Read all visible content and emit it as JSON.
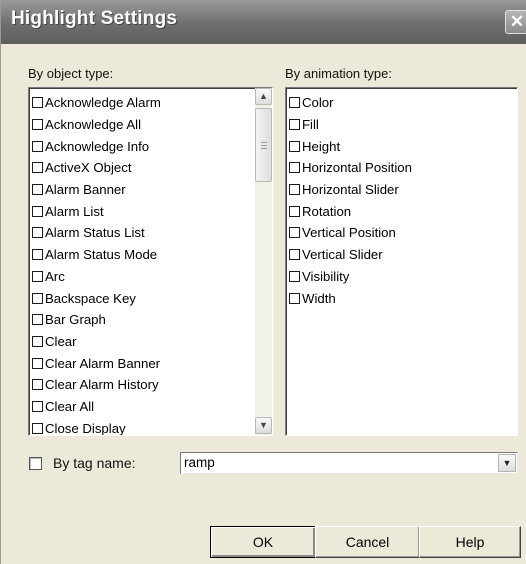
{
  "window": {
    "title": "Highlight Settings",
    "close_glyph": "✕"
  },
  "object_group": {
    "label": "By object type:",
    "items": [
      "Acknowledge Alarm",
      "Acknowledge All",
      "Acknowledge Info",
      "ActiveX Object",
      "Alarm Banner",
      "Alarm List",
      "Alarm Status List",
      "Alarm Status Mode",
      "Arc",
      "Backspace Key",
      "Bar Graph",
      "Clear",
      "Clear Alarm Banner",
      "Clear Alarm History",
      "Clear All",
      "Close Display"
    ]
  },
  "animation_group": {
    "label": "By animation type:",
    "items": [
      "Color",
      "Fill",
      "Height",
      "Horizontal Position",
      "Horizontal Slider",
      "Rotation",
      "Vertical Position",
      "Vertical Slider",
      "Visibility",
      "Width"
    ]
  },
  "tag": {
    "label": "By tag name:",
    "value": "ramp",
    "checked": false
  },
  "buttons": {
    "ok": "OK",
    "cancel": "Cancel",
    "help": "Help"
  }
}
